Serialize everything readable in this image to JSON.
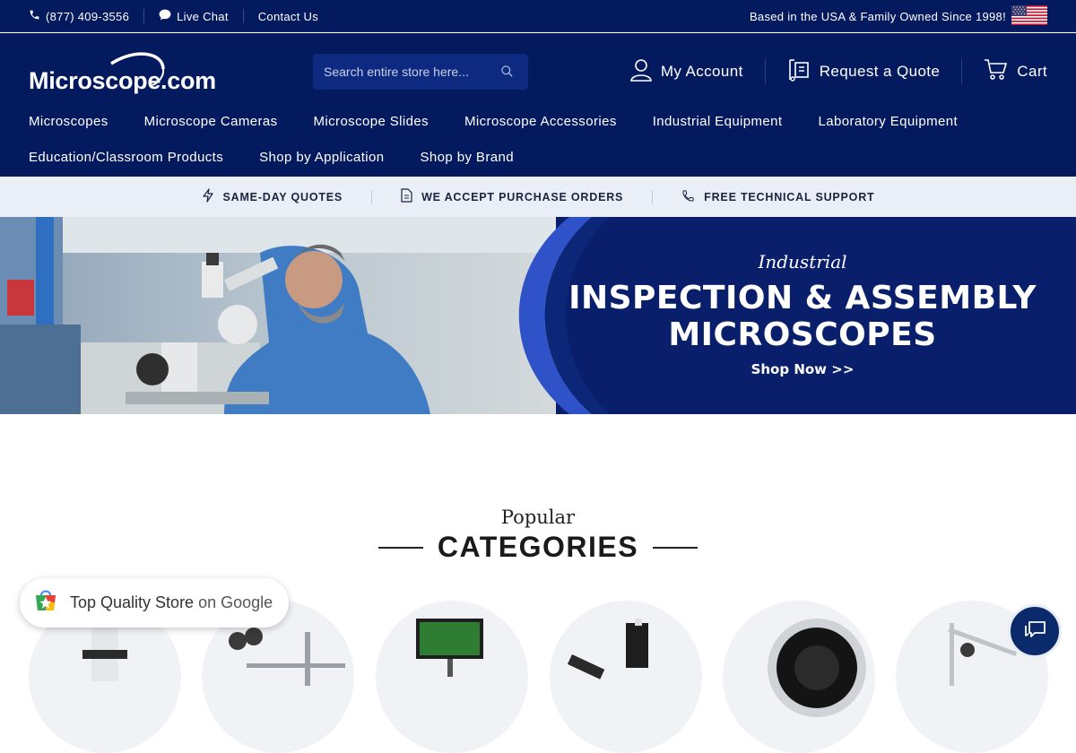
{
  "topbar": {
    "phone": "(877) 409-3556",
    "live_chat": "Live Chat",
    "contact": "Contact Us",
    "tagline": "Based in the USA & Family Owned Since 1998!"
  },
  "header": {
    "logo_text": "Microscope.com",
    "search_placeholder": "Search entire store here...",
    "my_account": "My Account",
    "request_quote": "Request a Quote",
    "cart": "Cart"
  },
  "nav": {
    "row1": [
      "Microscopes",
      "Microscope Cameras",
      "Microscope Slides",
      "Microscope Accessories",
      "Industrial Equipment",
      "Laboratory Equipment"
    ],
    "row2": [
      "Education/Classroom Products",
      "Shop by Application",
      "Shop by Brand"
    ]
  },
  "benefits": [
    "SAME-DAY QUOTES",
    "WE ACCEPT PURCHASE ORDERS",
    "FREE TECHNICAL SUPPORT"
  ],
  "hero": {
    "subtitle": "Industrial",
    "title_line1": "INSPECTION & ASSEMBLY",
    "title_line2": "MICROSCOPES",
    "cta": "Shop Now >>"
  },
  "categories": {
    "label": "Popular",
    "title": "CATEGORIES"
  },
  "google_badge": {
    "text": "Top Quality Store",
    "suffix": "on Google"
  },
  "colors": {
    "navy": "#041a5e",
    "hero_blue": "#0a1f6b",
    "benefits_bg": "#eaeef6"
  }
}
